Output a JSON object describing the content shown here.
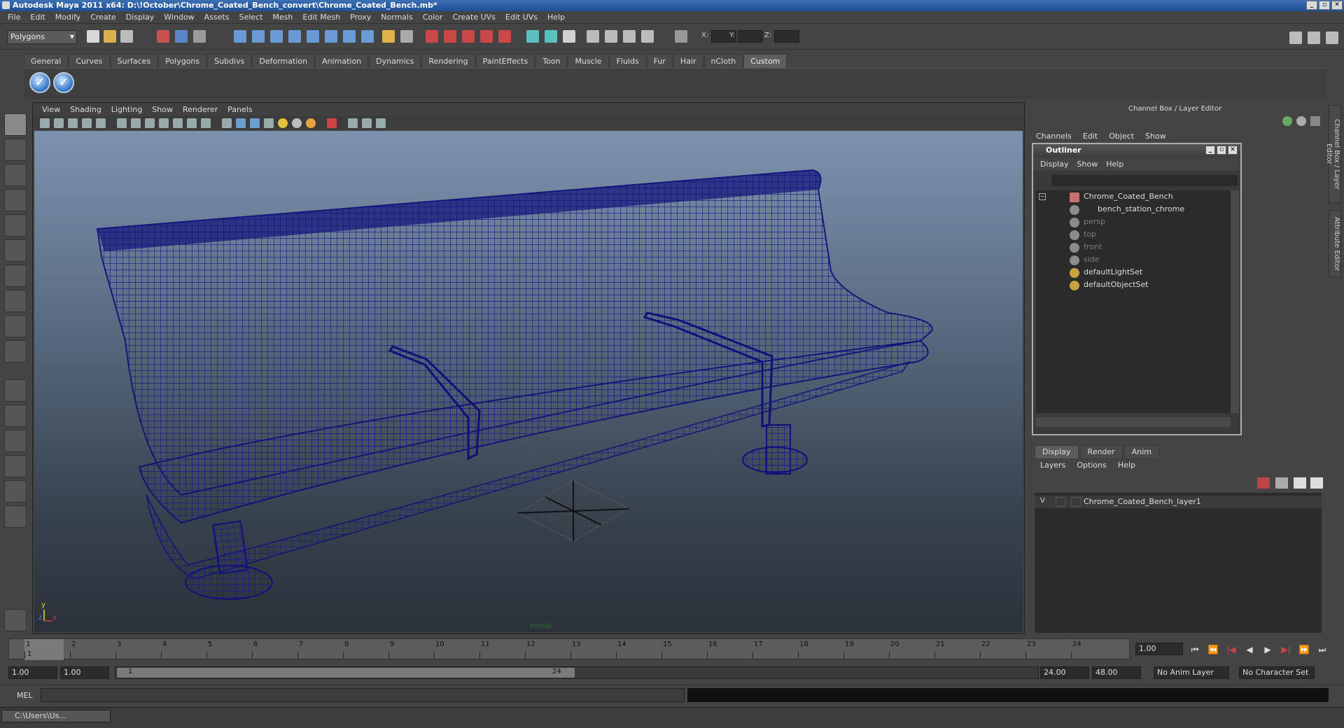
{
  "window": {
    "title": "Autodesk Maya 2011 x64: D:\\!October\\Chrome_Coated_Bench_convert\\Chrome_Coated_Bench.mb*"
  },
  "menubar": [
    "File",
    "Edit",
    "Modify",
    "Create",
    "Display",
    "Window",
    "Assets",
    "Select",
    "Mesh",
    "Edit Mesh",
    "Proxy",
    "Normals",
    "Color",
    "Create UVs",
    "Edit UVs",
    "Help"
  ],
  "statusline": {
    "menu_set": "Polygons",
    "x_label": "X:",
    "y_label": "Y:",
    "z_label": "Z:"
  },
  "shelf": {
    "tabs": [
      "General",
      "Curves",
      "Surfaces",
      "Polygons",
      "Subdivs",
      "Deformation",
      "Animation",
      "Dynamics",
      "Rendering",
      "PaintEffects",
      "Toon",
      "Muscle",
      "Fluids",
      "Fur",
      "Hair",
      "nCloth",
      "Custom"
    ],
    "active_tab": "Custom",
    "buttons": [
      "check-icon",
      "check-icon"
    ]
  },
  "viewport": {
    "menu": [
      "View",
      "Shading",
      "Lighting",
      "Show",
      "Renderer",
      "Panels"
    ],
    "camera": "persp",
    "axis_y": "y",
    "axis_x": "x",
    "axis_z": "z"
  },
  "channel_box": {
    "title": "Channel Box / Layer Editor",
    "menu": [
      "Channels",
      "Edit",
      "Object",
      "Show"
    ]
  },
  "outliner": {
    "title": "Outliner",
    "menu": [
      "Display",
      "Show",
      "Help"
    ],
    "items": [
      {
        "label": "Chrome_Coated_Bench",
        "dim": false
      },
      {
        "label": "bench_station_chrome",
        "dim": false
      },
      {
        "label": "persp",
        "dim": true
      },
      {
        "label": "top",
        "dim": true
      },
      {
        "label": "front",
        "dim": true
      },
      {
        "label": "side",
        "dim": true
      },
      {
        "label": "defaultLightSet",
        "dim": false
      },
      {
        "label": "defaultObjectSet",
        "dim": false
      }
    ]
  },
  "layer_editor": {
    "tabs": [
      "Display",
      "Render",
      "Anim"
    ],
    "active_tab": "Display",
    "menu": [
      "Layers",
      "Options",
      "Help"
    ],
    "layers": [
      {
        "visible": "V",
        "name": "Chrome_Coated_Bench_layer1"
      }
    ]
  },
  "side_tabs": [
    "Channel Box / Layer Editor",
    "Attribute Editor"
  ],
  "timeline": {
    "ticks": [
      "1",
      "2",
      "3",
      "4",
      "5",
      "6",
      "7",
      "8",
      "9",
      "10",
      "11",
      "12",
      "13",
      "14",
      "15",
      "16",
      "17",
      "18",
      "19",
      "20",
      "21",
      "22",
      "23",
      "24"
    ],
    "current_frame": "1",
    "current_time_field": "1.00"
  },
  "range": {
    "start_time": "1.00",
    "playback_start": "1.00",
    "slider_start": "1",
    "slider_end": "24",
    "playback_end": "24.00",
    "end_time": "48.00",
    "anim_layer": "No Anim Layer",
    "character_set": "No Character Set"
  },
  "command_line": {
    "label": "MEL"
  },
  "taskbar": {
    "item": "C:\\Users\\Us..."
  }
}
